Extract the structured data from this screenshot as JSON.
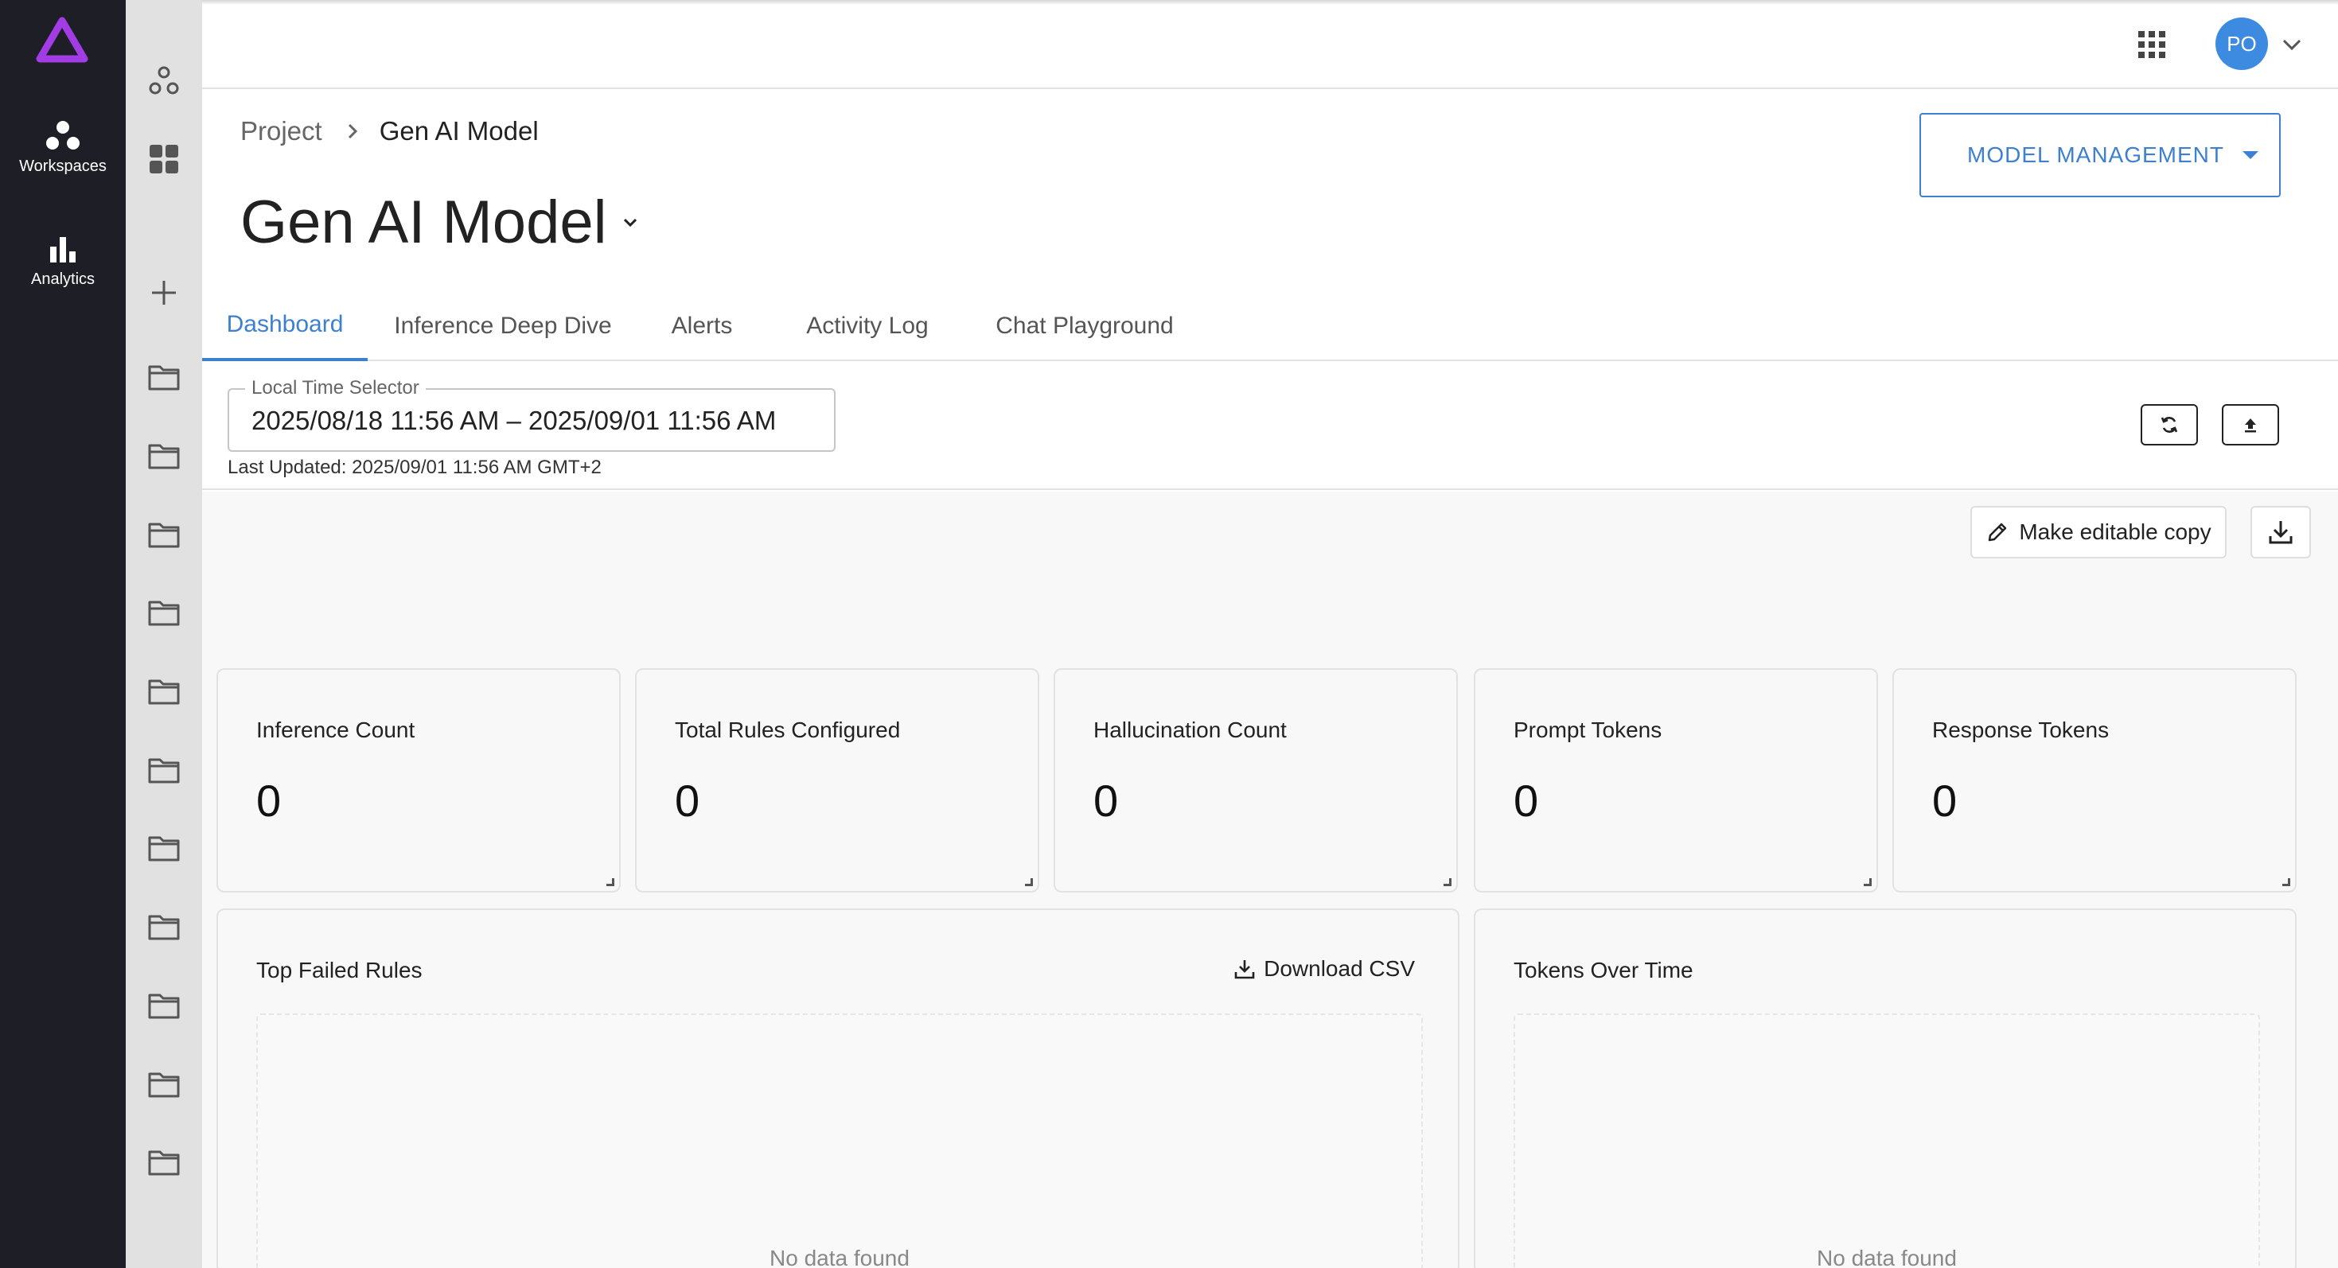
{
  "rail": {
    "items": [
      {
        "label": "Workspaces",
        "icon": "workspaces-icon"
      },
      {
        "label": "Analytics",
        "icon": "analytics-icon"
      }
    ]
  },
  "header": {
    "avatar_initials": "PO"
  },
  "breadcrumb": {
    "project": "Project",
    "current": "Gen AI Model"
  },
  "page": {
    "title": "Gen AI Model",
    "model_management_label": "MODEL MANAGEMENT"
  },
  "tabs": [
    {
      "label": "Dashboard",
      "active": true
    },
    {
      "label": "Inference Deep Dive",
      "active": false
    },
    {
      "label": "Alerts",
      "active": false
    },
    {
      "label": "Activity Log",
      "active": false
    },
    {
      "label": "Chat Playground",
      "active": false
    }
  ],
  "time_selector": {
    "label": "Local Time Selector",
    "value": "2025/08/18 11:56 AM – 2025/09/01 11:56 AM",
    "last_updated": "Last Updated: 2025/09/01 11:56 AM GMT+2"
  },
  "dashboard": {
    "make_copy_label": "Make editable copy",
    "stats": [
      {
        "title": "Inference Count",
        "value": "0"
      },
      {
        "title": "Total Rules Configured",
        "value": "0"
      },
      {
        "title": "Hallucination Count",
        "value": "0"
      },
      {
        "title": "Prompt Tokens",
        "value": "0"
      },
      {
        "title": "Response Tokens",
        "value": "0"
      }
    ],
    "top_failed_rules": {
      "title": "Top Failed Rules",
      "download_label": "Download CSV",
      "empty_text": "No data found"
    },
    "tokens_over_time": {
      "title": "Tokens Over Time",
      "empty_text": "No data found"
    }
  },
  "colors": {
    "accent": "#3d7fd1",
    "rail_bg": "#1e1f26",
    "logo": "#a23de6",
    "avatar": "#3d8be0"
  }
}
